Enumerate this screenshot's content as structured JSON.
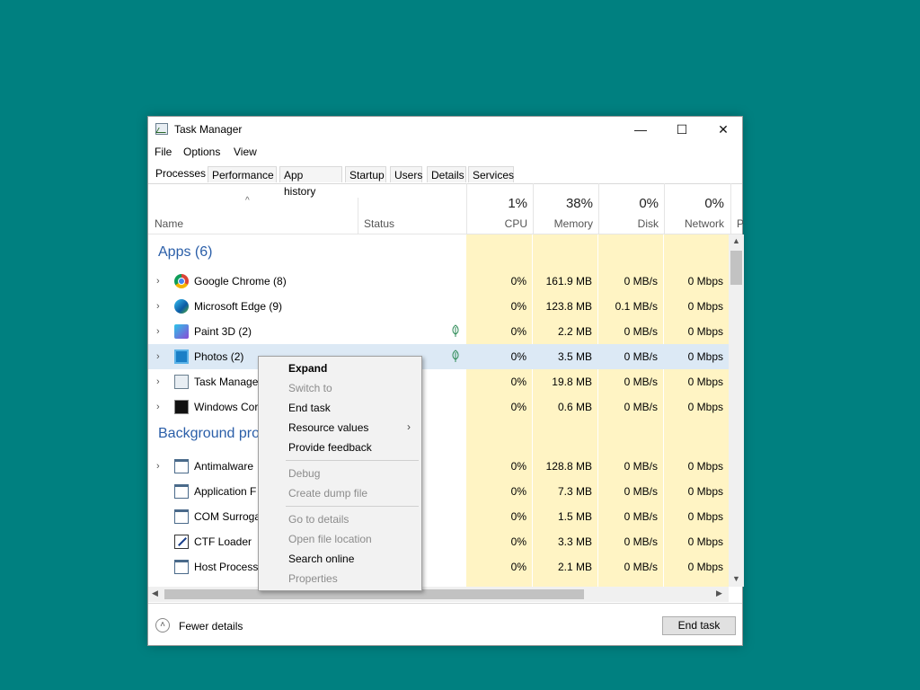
{
  "window": {
    "title": "Task Manager",
    "minimize": "—",
    "maximize": "☐",
    "close": "✕"
  },
  "menubar": [
    "File",
    "Options",
    "View"
  ],
  "tabs": [
    "Processes",
    "Performance",
    "App history",
    "Startup",
    "Users",
    "Details",
    "Services"
  ],
  "header": {
    "sort_arrow": "^",
    "name": "Name",
    "status": "Status",
    "cpu_pct": "1%",
    "cpu": "CPU",
    "mem_pct": "38%",
    "mem": "Memory",
    "disk_pct": "0%",
    "disk": "Disk",
    "net_pct": "0%",
    "net": "Network",
    "power_trunc": "P"
  },
  "groups": {
    "apps": "Apps (6)",
    "background": "Background pro"
  },
  "apps": [
    {
      "name": "Google Chrome (8)",
      "cpu": "0%",
      "mem": "161.9 MB",
      "disk": "0 MB/s",
      "net": "0 Mbps",
      "icon": "chrome-icon"
    },
    {
      "name": "Microsoft Edge (9)",
      "cpu": "0%",
      "mem": "123.8 MB",
      "disk": "0.1 MB/s",
      "net": "0 Mbps",
      "icon": "edge-icon"
    },
    {
      "name": "Paint 3D (2)",
      "cpu": "0%",
      "mem": "2.2 MB",
      "disk": "0 MB/s",
      "net": "0 Mbps",
      "icon": "paint3d-icon"
    },
    {
      "name": "Photos (2)",
      "cpu": "0%",
      "mem": "3.5 MB",
      "disk": "0 MB/s",
      "net": "0 Mbps",
      "icon": "photos-icon"
    },
    {
      "name": "Task Manager",
      "cpu": "0%",
      "mem": "19.8 MB",
      "disk": "0 MB/s",
      "net": "0 Mbps",
      "icon": "task-manager-icon"
    },
    {
      "name": "Windows Cor",
      "cpu": "0%",
      "mem": "0.6 MB",
      "disk": "0 MB/s",
      "net": "0 Mbps",
      "icon": "console-icon"
    }
  ],
  "background": [
    {
      "name": "Antimalware",
      "cpu": "0%",
      "mem": "128.8 MB",
      "disk": "0 MB/s",
      "net": "0 Mbps"
    },
    {
      "name": "Application F",
      "cpu": "0%",
      "mem": "7.3 MB",
      "disk": "0 MB/s",
      "net": "0 Mbps"
    },
    {
      "name": "COM Surroga",
      "cpu": "0%",
      "mem": "1.5 MB",
      "disk": "0 MB/s",
      "net": "0 Mbps"
    },
    {
      "name": "CTF Loader",
      "cpu": "0%",
      "mem": "3.3 MB",
      "disk": "0 MB/s",
      "net": "0 Mbps"
    },
    {
      "name": "Host Process",
      "cpu": "0%",
      "mem": "2.1 MB",
      "disk": "0 MB/s",
      "net": "0 Mbps"
    }
  ],
  "context_menu": {
    "expand": "Expand",
    "switch_to": "Switch to",
    "end_task": "End task",
    "resource_values": "Resource values",
    "provide_feedback": "Provide feedback",
    "debug": "Debug",
    "create_dump": "Create dump file",
    "go_to_details": "Go to details",
    "open_file_location": "Open file location",
    "search_online": "Search online",
    "properties": "Properties"
  },
  "footer": {
    "fewer_details": "Fewer details",
    "end_task": "End task"
  },
  "colors": {
    "desktop": "#008080",
    "heat": "#fff4c4",
    "selected_row": "#dce9f5",
    "group_text": "#2a5ea8"
  }
}
